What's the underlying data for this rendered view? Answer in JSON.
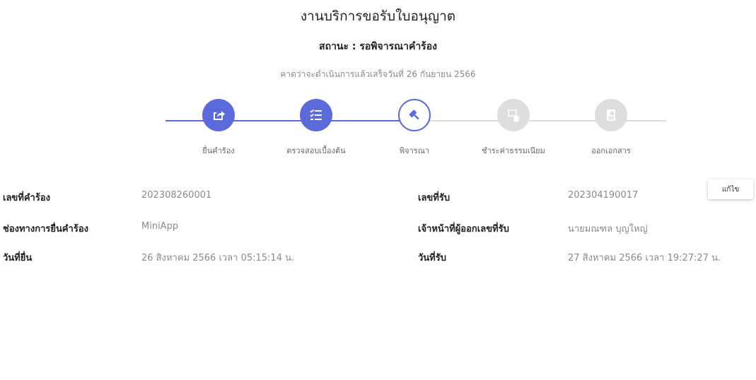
{
  "header": {
    "title": "งานบริการขอรับใบอนุญาต",
    "status": "สถานะ : รอพิจารณาคำร้อง",
    "expected": "คาดว่าจะดำเนินการแล้วเสร็จวันที่ 26 กันยายน 2566"
  },
  "steps": [
    {
      "label": "ยื่นคำร้อง",
      "icon": "share-icon",
      "state": "done"
    },
    {
      "label": "ตรวจสอบเบื้องต้น",
      "icon": "checklist-icon",
      "state": "done"
    },
    {
      "label": "พิจารณา",
      "icon": "gavel-icon",
      "state": "active"
    },
    {
      "label": "ชำระค่าธรรมเนียม",
      "icon": "payment-icon",
      "state": "pending"
    },
    {
      "label": "ออกเอกสาร",
      "icon": "document-icon",
      "state": "pending"
    }
  ],
  "colors": {
    "accent": "#5b6bdb",
    "pending": "#dedede"
  },
  "details": {
    "left": [
      {
        "label": "เลขที่คำร้อง",
        "value": "202308260001"
      },
      {
        "label": "ช่องทางการยื่นคำร้อง",
        "value": "MiniApp"
      },
      {
        "label": "วันที่ยื่น",
        "value": "26 สิงหาคม 2566 เวลา 05:15:14 น."
      }
    ],
    "right": [
      {
        "label": "เลขที่รับ",
        "value": "202304190017"
      },
      {
        "label": "เจ้าหน้าที่ผู้ออกเลขที่รับ",
        "value": "นายมณฑล บุญใหญ่"
      },
      {
        "label": "วันที่รับ",
        "value": "27 สิงหาคม 2566 เวลา 19:27:27 น."
      }
    ]
  },
  "edit_button": "แก้ไข"
}
